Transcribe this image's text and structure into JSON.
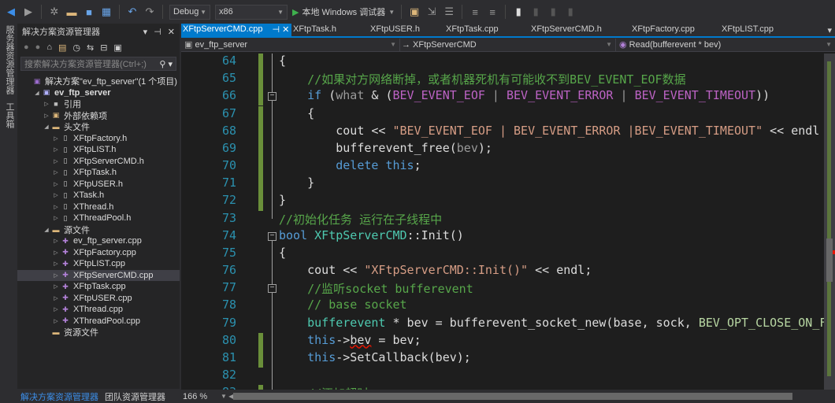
{
  "toolbar": {
    "config": "Debug",
    "platform": "x86",
    "run_label": "本地 Windows 调试器"
  },
  "left_strip": {
    "server_explorer": "服务器资源管理器",
    "toolbox": "工具箱"
  },
  "solution_explorer": {
    "title": "解决方案资源管理器",
    "search_placeholder": "搜索解决方案资源管理器(Ctrl+;)",
    "items": [
      {
        "label": "解决方案\"ev_ftp_server\"(1 个项目)",
        "level": 0,
        "icon": "solution-icon",
        "twisty": ""
      },
      {
        "label": "ev_ftp_server",
        "level": 1,
        "icon": "project-icon",
        "twisty": "◢",
        "bold": true
      },
      {
        "label": "引用",
        "level": 2,
        "icon": "references-icon",
        "twisty": "▷"
      },
      {
        "label": "外部依赖项",
        "level": 2,
        "icon": "external-deps-icon",
        "twisty": "▷"
      },
      {
        "label": "头文件",
        "level": 2,
        "icon": "folder-icon",
        "twisty": "◢"
      },
      {
        "label": "XFtpFactory.h",
        "level": 3,
        "icon": "header-file-icon",
        "twisty": "▷"
      },
      {
        "label": "XFtpLIST.h",
        "level": 3,
        "icon": "header-file-icon",
        "twisty": "▷"
      },
      {
        "label": "XFtpServerCMD.h",
        "level": 3,
        "icon": "header-file-icon",
        "twisty": "▷"
      },
      {
        "label": "XFtpTask.h",
        "level": 3,
        "icon": "header-file-icon",
        "twisty": "▷"
      },
      {
        "label": "XFtpUSER.h",
        "level": 3,
        "icon": "header-file-icon",
        "twisty": "▷"
      },
      {
        "label": "XTask.h",
        "level": 3,
        "icon": "header-file-icon",
        "twisty": "▷"
      },
      {
        "label": "XThread.h",
        "level": 3,
        "icon": "header-file-icon",
        "twisty": "▷"
      },
      {
        "label": "XThreadPool.h",
        "level": 3,
        "icon": "header-file-icon",
        "twisty": "▷"
      },
      {
        "label": "源文件",
        "level": 2,
        "icon": "folder-icon",
        "twisty": "◢"
      },
      {
        "label": "ev_ftp_server.cpp",
        "level": 3,
        "icon": "cpp-file-icon",
        "twisty": "▷"
      },
      {
        "label": "XFtpFactory.cpp",
        "level": 3,
        "icon": "cpp-file-icon",
        "twisty": "▷"
      },
      {
        "label": "XFtpLIST.cpp",
        "level": 3,
        "icon": "cpp-file-icon",
        "twisty": "▷"
      },
      {
        "label": "XFtpServerCMD.cpp",
        "level": 3,
        "icon": "cpp-file-icon",
        "twisty": "▷",
        "selected": true
      },
      {
        "label": "XFtpTask.cpp",
        "level": 3,
        "icon": "cpp-file-icon",
        "twisty": "▷"
      },
      {
        "label": "XFtpUSER.cpp",
        "level": 3,
        "icon": "cpp-file-icon",
        "twisty": "▷"
      },
      {
        "label": "XThread.cpp",
        "level": 3,
        "icon": "cpp-file-icon",
        "twisty": "▷"
      },
      {
        "label": "XThreadPool.cpp",
        "level": 3,
        "icon": "cpp-file-icon",
        "twisty": "▷"
      },
      {
        "label": "资源文件",
        "level": 2,
        "icon": "folder-icon",
        "twisty": ""
      }
    ],
    "bottom_tabs": [
      "解决方案资源管理器",
      "团队资源管理器"
    ]
  },
  "editor": {
    "tabs": [
      {
        "label": "XFtpServerCMD.cpp",
        "active": true
      },
      {
        "label": "XFtpTask.h"
      },
      {
        "label": "XFtpUSER.h"
      },
      {
        "label": "XFtpTask.cpp"
      },
      {
        "label": "XFtpServerCMD.h"
      },
      {
        "label": "XFtpFactory.cpp"
      },
      {
        "label": "XFtpLIST.cpp"
      }
    ],
    "nav": {
      "project": "ev_ftp_server",
      "class": "→ XFtpServerCMD",
      "member": "Read(bufferevent * bev)"
    },
    "zoom": "166 %",
    "lines": [
      {
        "n": "64",
        "chg": true,
        "t": [
          [
            "{",
            "pl"
          ]
        ]
      },
      {
        "n": "65",
        "chg": true,
        "t": [
          [
            "    //如果对方网络断掉，或者机器死机有可能收不到BEV_EVENT_EOF数据",
            "cm"
          ]
        ]
      },
      {
        "n": "66",
        "chg": true,
        "fold": true,
        "t": [
          [
            "    if",
            "kw"
          ],
          [
            " (",
            "pl"
          ],
          [
            "what",
            "pa"
          ],
          [
            " & (",
            "pl"
          ],
          [
            "BEV_EVENT_EOF",
            "mac"
          ],
          [
            " | ",
            "pa"
          ],
          [
            "BEV_EVENT_ERROR",
            "mac"
          ],
          [
            " | ",
            "pa"
          ],
          [
            "BEV_EVENT_TIMEOUT",
            "mac"
          ],
          [
            "))",
            "pl"
          ]
        ]
      },
      {
        "n": "67",
        "chg": true,
        "t": [
          [
            "    {",
            "pl"
          ]
        ]
      },
      {
        "n": "68",
        "chg": true,
        "t": [
          [
            "        cout << ",
            "pl"
          ],
          [
            "\"BEV_EVENT_EOF | BEV_EVENT_ERROR |BEV_EVENT_TIMEOUT\"",
            "st"
          ],
          [
            " << endl",
            "pl"
          ]
        ]
      },
      {
        "n": "69",
        "chg": true,
        "t": [
          [
            "        bufferevent_free(",
            "pl"
          ],
          [
            "bev",
            "pa"
          ],
          [
            ");",
            "pl"
          ]
        ]
      },
      {
        "n": "70",
        "chg": true,
        "t": [
          [
            "        delete",
            "kw"
          ],
          [
            " ",
            "pl"
          ],
          [
            "this",
            "kw"
          ],
          [
            ";",
            "pl"
          ]
        ]
      },
      {
        "n": "71",
        "chg": true,
        "t": [
          [
            "    }",
            "pl"
          ]
        ]
      },
      {
        "n": "72",
        "chg": true,
        "t": [
          [
            "}",
            "pl"
          ]
        ]
      },
      {
        "n": "73",
        "t": [
          [
            "//初始化任务 运行在子线程中",
            "cm"
          ]
        ]
      },
      {
        "n": "74",
        "fold": true,
        "t": [
          [
            "bool",
            "kw"
          ],
          [
            " ",
            "pl"
          ],
          [
            "XFtpServerCMD",
            "ty"
          ],
          [
            "::Init()",
            "pl"
          ]
        ]
      },
      {
        "n": "75",
        "t": [
          [
            "{",
            "pl"
          ]
        ]
      },
      {
        "n": "76",
        "t": [
          [
            "    cout << ",
            "pl"
          ],
          [
            "\"XFtpServerCMD::Init()\"",
            "st"
          ],
          [
            " << endl;",
            "pl"
          ]
        ]
      },
      {
        "n": "77",
        "fold": true,
        "t": [
          [
            "    //监听socket bufferevent",
            "cm"
          ]
        ]
      },
      {
        "n": "78",
        "t": [
          [
            "    // base socket",
            "cm"
          ]
        ]
      },
      {
        "n": "79",
        "t": [
          [
            "    ",
            "pl"
          ],
          [
            "bufferevent",
            "ty"
          ],
          [
            " * bev = bufferevent_socket_new(base, sock, ",
            "pl"
          ],
          [
            "BEV_OPT_CLOSE_ON_FREE",
            "en"
          ]
        ]
      },
      {
        "n": "80",
        "chg": true,
        "t": [
          [
            "    this",
            "kw"
          ],
          [
            "->",
            "pl"
          ],
          [
            "bev",
            "squig"
          ],
          [
            " = bev;",
            "pl"
          ]
        ]
      },
      {
        "n": "81",
        "chg": true,
        "t": [
          [
            "    this",
            "kw"
          ],
          [
            "->SetCallback(bev);",
            "pl"
          ]
        ]
      },
      {
        "n": "82",
        "t": [
          [
            "",
            "pl"
          ]
        ]
      },
      {
        "n": "83",
        "chg": true,
        "t": [
          [
            "    //添加超时",
            "cm"
          ]
        ]
      }
    ]
  }
}
